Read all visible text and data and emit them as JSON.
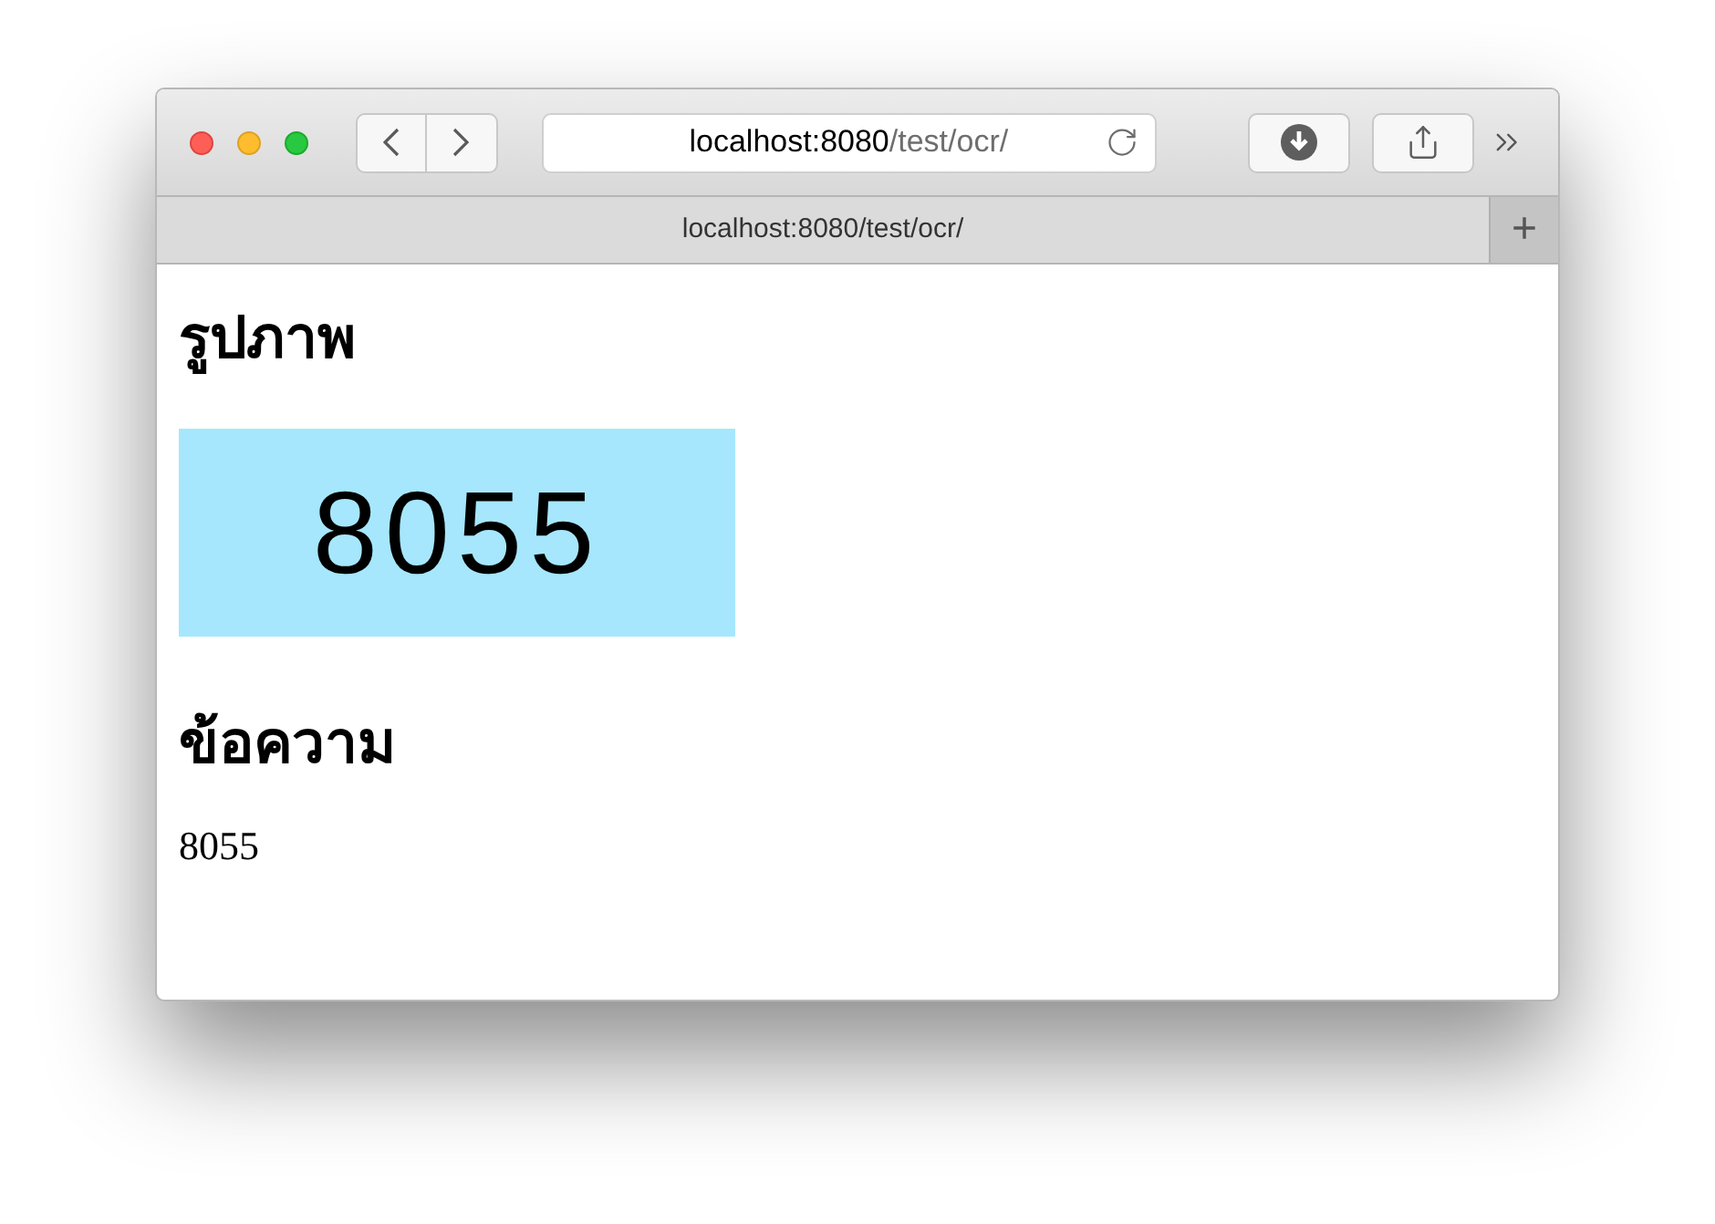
{
  "browser": {
    "address": {
      "host": "localhost:8080",
      "path": "/test/ocr/"
    },
    "tab_title": "localhost:8080/test/ocr/",
    "new_tab": "+"
  },
  "page": {
    "image_heading": "รูปภาพ",
    "image_text": "8055",
    "text_heading": "ข้อความ",
    "text_value": "8055"
  }
}
